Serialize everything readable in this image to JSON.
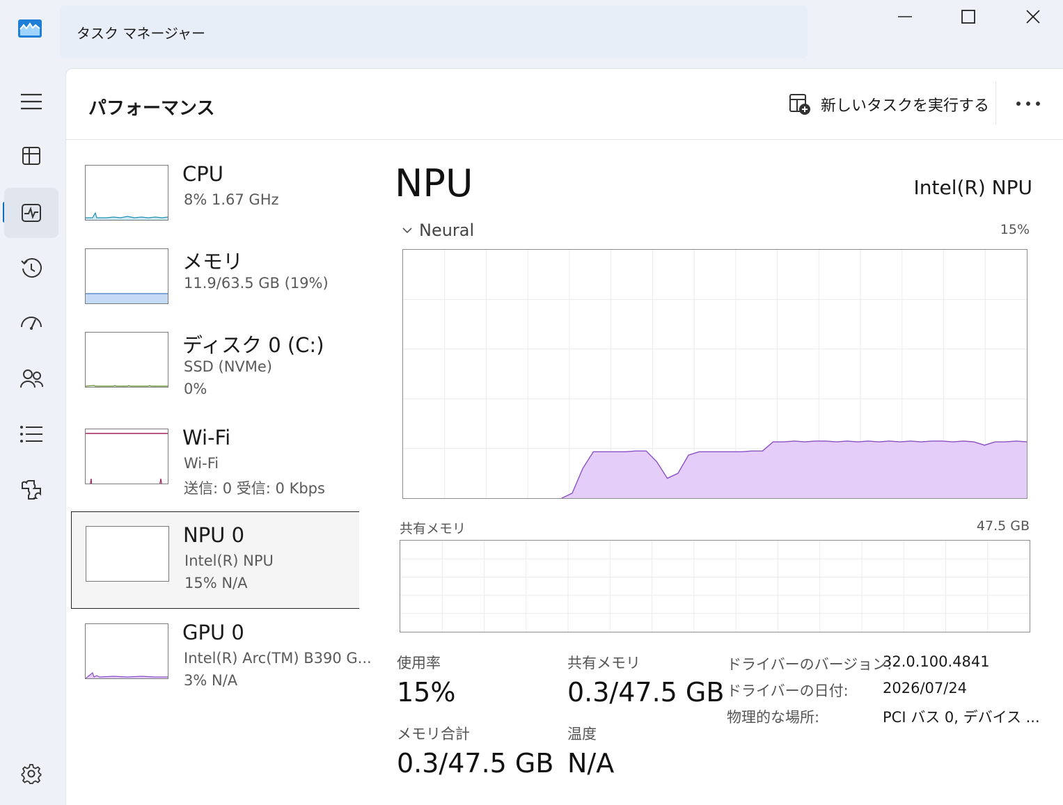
{
  "window": {
    "title": "タスク マネージャー"
  },
  "nav": {
    "items": [
      {
        "icon": "hamburger-icon"
      },
      {
        "icon": "processes-icon"
      },
      {
        "icon": "performance-icon",
        "active": true
      },
      {
        "icon": "app-history-icon"
      },
      {
        "icon": "startup-apps-icon"
      },
      {
        "icon": "users-icon"
      },
      {
        "icon": "details-icon"
      },
      {
        "icon": "services-icon"
      },
      {
        "icon": "settings-icon"
      }
    ]
  },
  "header": {
    "title": "パフォーマンス",
    "run_task_label": "新しいタスクを実行する"
  },
  "resources": [
    {
      "name": "CPU",
      "line1": "8%  1.67 GHz",
      "line2": "",
      "color": "#1e8fb0",
      "value_pct": 8
    },
    {
      "name": "メモリ",
      "line1": "11.9/63.5 GB (19%)",
      "line2": "",
      "color": "#4a78c0",
      "value_pct": 19
    },
    {
      "name": "ディスク 0 (C:)",
      "line1": "SSD (NVMe)",
      "line2": "0%",
      "color": "#5c8a20",
      "value_pct": 0
    },
    {
      "name": "Wi-Fi",
      "line1": "Wi-Fi",
      "line2": "送信: 0  受信: 0 Kbps",
      "color": "#a0245a"
    },
    {
      "name": "NPU 0",
      "line1": "Intel(R) NPU",
      "line2": "15%  N/A",
      "color": "#8a4fc4",
      "value_pct": 15,
      "selected": true
    },
    {
      "name": "GPU 0",
      "line1": "Intel(R) Arc(TM) B390 G...",
      "line2": "3%  N/A",
      "color": "#8a4fc4",
      "value_pct": 3
    }
  ],
  "detail": {
    "title": "NPU",
    "model": "Intel(R) NPU",
    "graph1": {
      "label": "Neural",
      "max_label": "15%"
    },
    "graph2": {
      "label": "共有メモリ",
      "max_label": "47.5 GB"
    },
    "stats": {
      "usage_label": "使用率",
      "usage_value": "15%",
      "shared_label": "共有メモリ",
      "shared_value": "0.3/47.5 GB",
      "total_label": "メモリ合計",
      "total_value": "0.3/47.5 GB",
      "temp_label": "温度",
      "temp_value": "N/A"
    },
    "info": {
      "driver_version_label": "ドライバーのバージョン:",
      "driver_version_value": "32.0.100.4841",
      "driver_date_label": "ドライバーの日付:",
      "driver_date_value": "2026/07/24",
      "location_label": "物理的な場所:",
      "location_value": "PCI バス 0, デバイス ..."
    }
  },
  "chart_data": {
    "type": "area",
    "title": "Neural",
    "x": [
      0,
      1,
      2,
      3,
      4,
      5,
      6,
      7,
      8,
      9,
      10,
      11,
      12,
      13,
      14,
      15,
      16,
      17,
      18,
      19,
      20,
      21,
      22,
      23,
      24,
      25,
      26,
      27,
      28,
      29,
      30,
      31,
      32,
      33,
      34,
      35,
      36,
      37,
      38,
      39,
      40,
      41,
      42,
      43,
      44,
      45,
      46,
      47,
      48,
      49,
      50,
      51,
      52,
      53,
      54,
      55,
      56,
      57,
      58,
      59
    ],
    "values": [
      0,
      0,
      0,
      0,
      0,
      0,
      0,
      0,
      0,
      0,
      0,
      0,
      0,
      0,
      0,
      0,
      0.3,
      1.8,
      2.8,
      2.8,
      2.8,
      2.8,
      2.85,
      2.85,
      2.2,
      1.2,
      1.5,
      2.6,
      2.8,
      2.8,
      2.8,
      2.8,
      2.8,
      2.85,
      2.85,
      3.4,
      3.4,
      3.45,
      3.4,
      3.45,
      3.45,
      3.4,
      3.45,
      3.4,
      3.45,
      3.4,
      3.45,
      3.4,
      3.45,
      3.4,
      3.45,
      3.45,
      3.4,
      3.45,
      3.4,
      3.2,
      3.4,
      3.4,
      3.45,
      3.4
    ],
    "ylim": [
      0,
      15
    ],
    "colors": {
      "fill": "#e5cdf9",
      "stroke": "#8a4fc4"
    },
    "grid": true
  }
}
